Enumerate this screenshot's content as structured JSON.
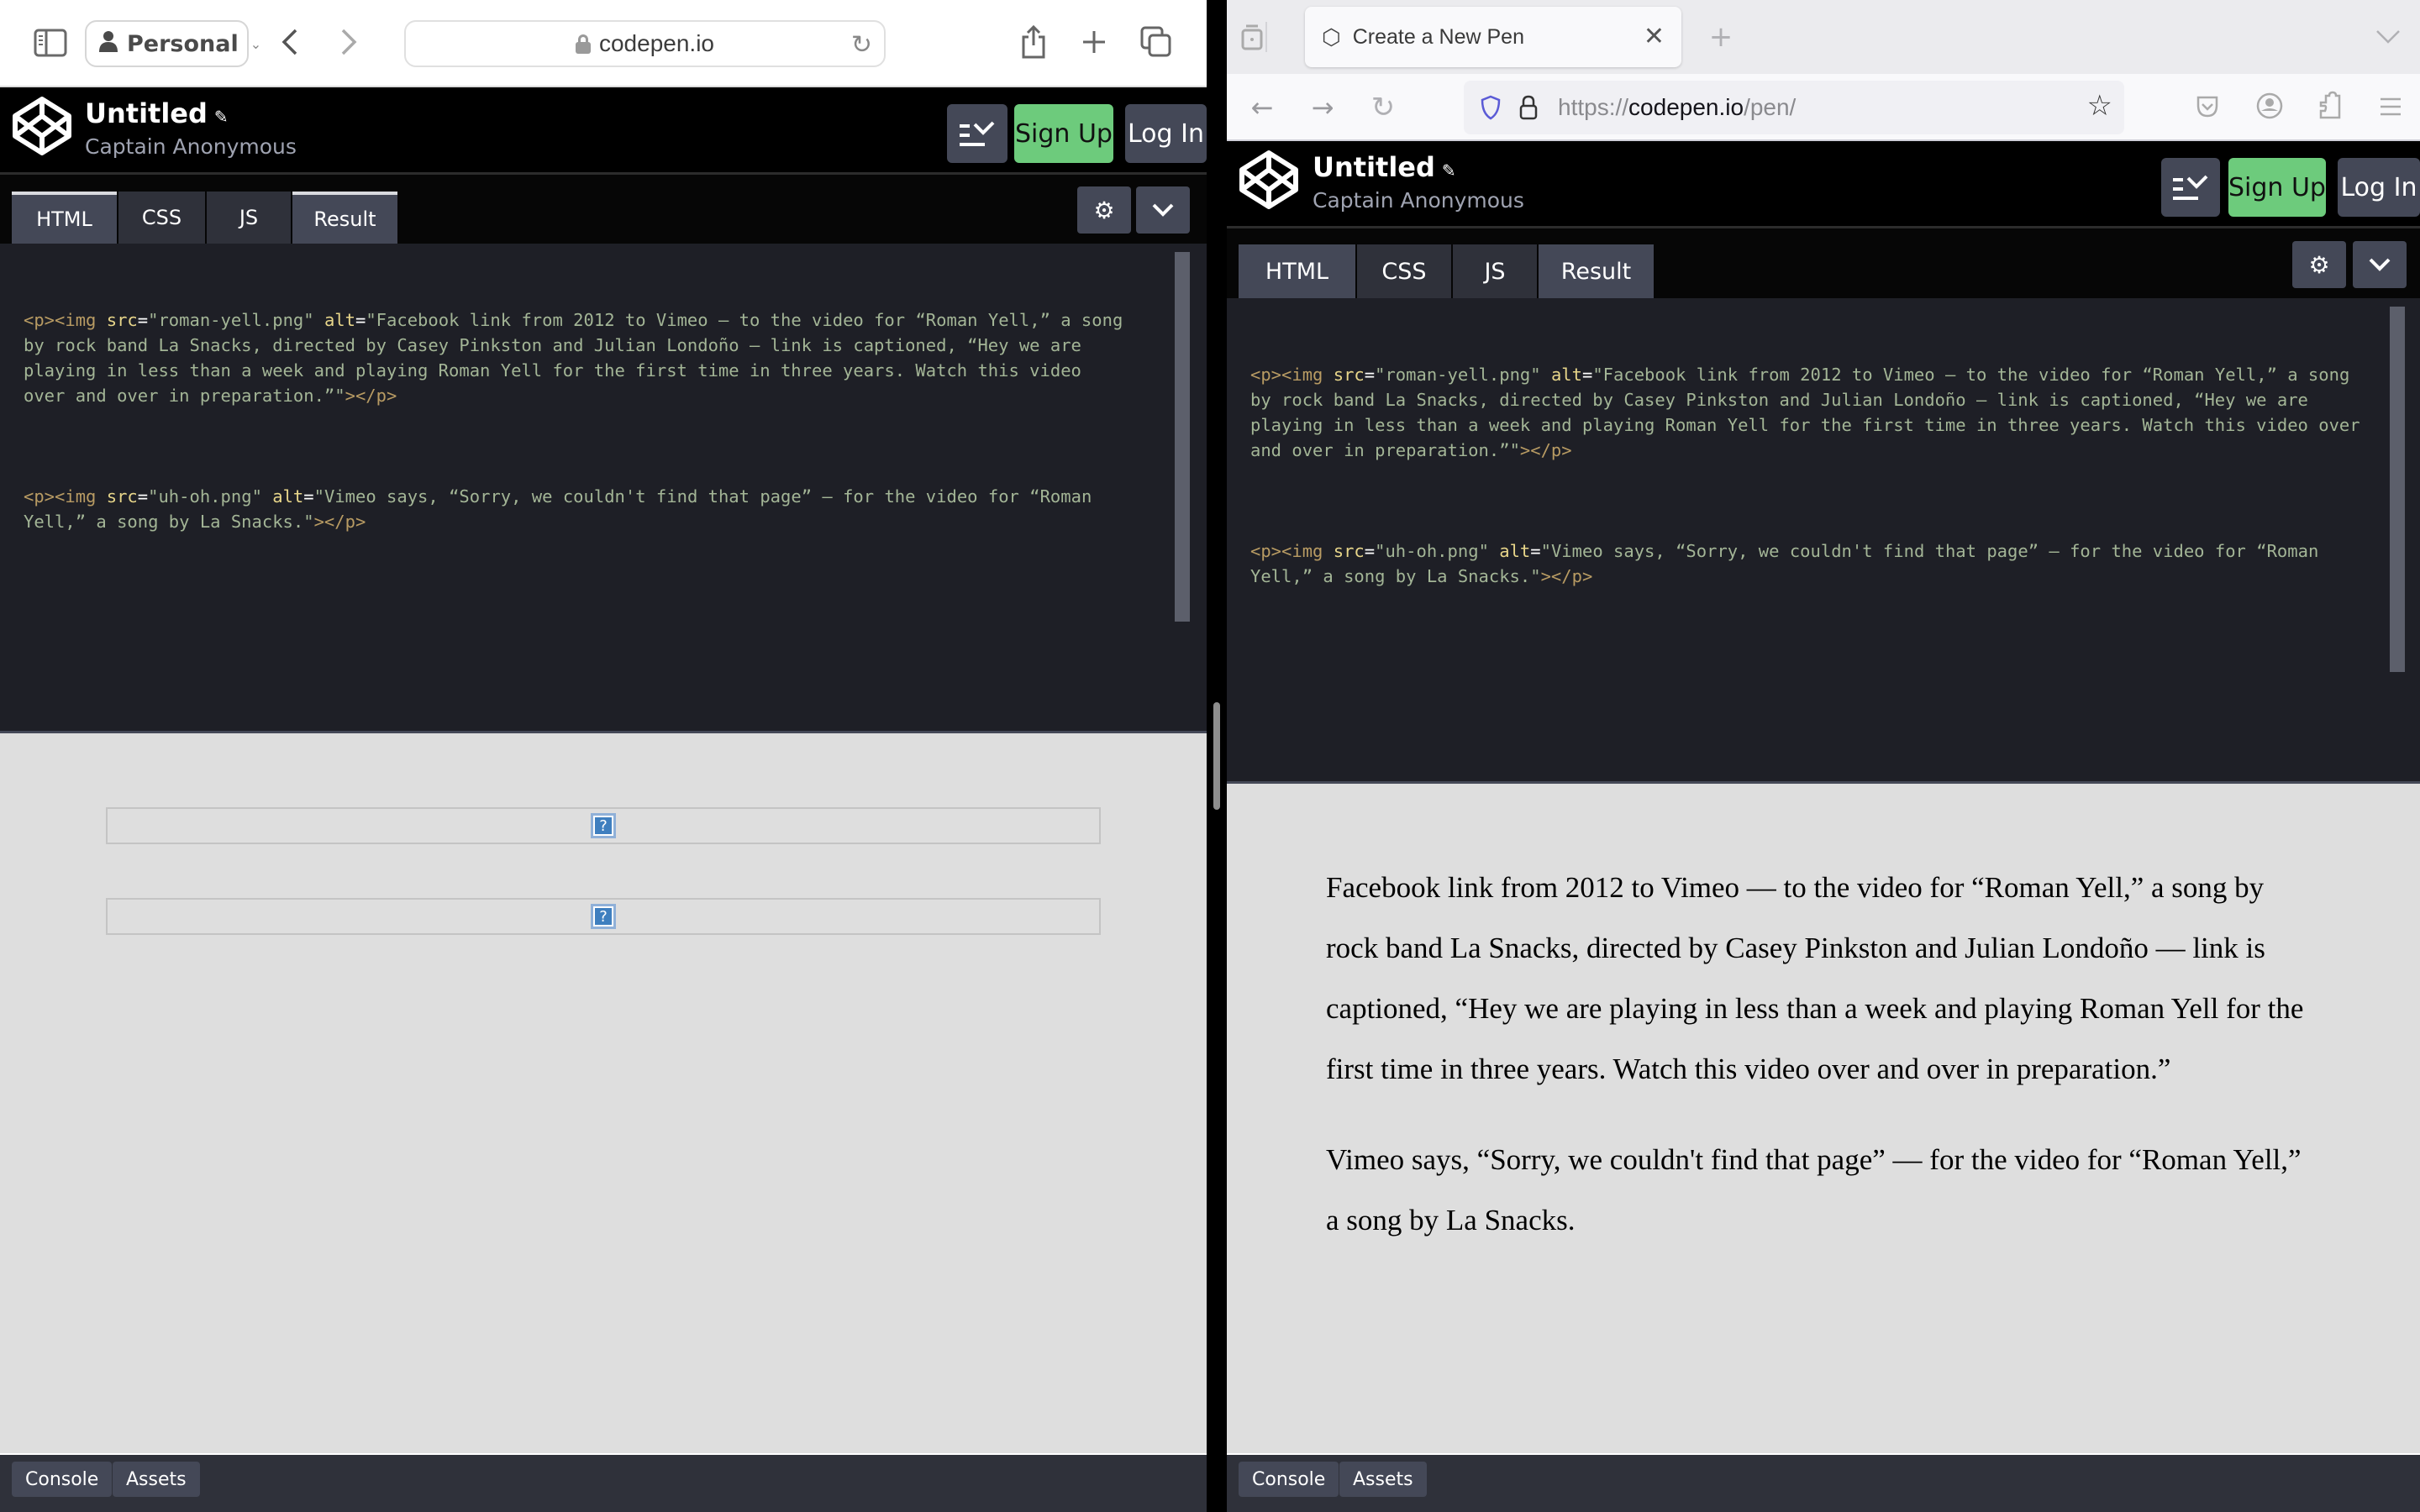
{
  "safari": {
    "profile_label": "Personal",
    "url": "codepen.io",
    "icons": [
      "sidebar-icon",
      "person-icon",
      "back-icon",
      "forward-icon",
      "lock-icon",
      "reload-icon",
      "share-icon",
      "new-tab-icon",
      "tabs-overview-icon"
    ]
  },
  "firefox": {
    "tab_title": "Create a New Pen",
    "url_prefix": "https://",
    "url_host": "codepen.io",
    "url_path": "/pen/",
    "icons": [
      "tab-groups-icon",
      "codepen-favicon",
      "close-icon",
      "new-tab-icon",
      "tab-list-icon",
      "back-icon",
      "forward-icon",
      "reload-icon",
      "shield-icon",
      "lock-icon",
      "bookmark-star-icon",
      "pocket-icon",
      "account-icon",
      "extensions-icon",
      "menu-icon"
    ]
  },
  "codepen": {
    "title": "Untitled",
    "user": "Captain Anonymous",
    "signup_label": "Sign Up",
    "login_label": "Log In",
    "tabs": [
      {
        "label": "HTML",
        "active": true
      },
      {
        "label": "CSS",
        "active": false
      },
      {
        "label": "JS",
        "active": false
      },
      {
        "label": "Result",
        "active": true
      }
    ],
    "code": [
      {
        "src": "roman-yell.png",
        "alt": "Facebook link from 2012 to Vimeo — to the video for “Roman Yell,” a song by rock band La Snacks, directed by Casey Pinkston and Julian Londoño — link is captioned, “Hey we are playing in less than a week and playing Roman Yell for the first time in three years. Watch this video over and over in preparation.”"
      },
      {
        "src": "uh-oh.png",
        "alt": "Vimeo says, “Sorry, we couldn't find that page” — for the video for “Roman Yell,” a song by La Snacks."
      }
    ],
    "tokens": {
      "open_p": "<p>",
      "open_img": "<img",
      "src_attr": "src",
      "alt_attr": "alt",
      "eq": "=",
      "close": "></p>"
    },
    "left_result": {
      "broken_image_glyph": "?"
    },
    "right_result": {
      "paragraphs": [
        "Facebook link from 2012 to Vimeo — to the video for “Roman Yell,” a song by rock band La Snacks, directed by Casey Pinkston and Julian Londoño — link is captioned, “Hey we are playing in less than a week and playing Roman Yell for the first time in three years. Watch this video over and over in preparation.”",
        "Vimeo says, “Sorry, we couldn't find that page” — for the video for “Roman Yell,” a song by La Snacks."
      ]
    },
    "console_label": "Console",
    "assets_label": "Assets"
  },
  "colors": {
    "signup_green": "#6dcb7c",
    "button_gray": "#444857",
    "editor_bg": "#1e1f26",
    "result_bg": "#dedede"
  }
}
